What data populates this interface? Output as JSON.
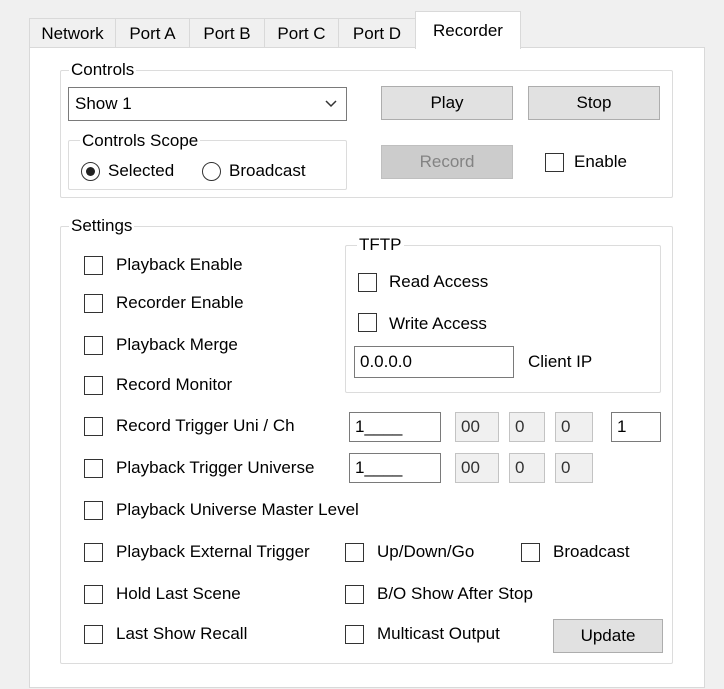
{
  "tabs": [
    {
      "label": "Network"
    },
    {
      "label": "Port A"
    },
    {
      "label": "Port B"
    },
    {
      "label": "Port C"
    },
    {
      "label": "Port D"
    },
    {
      "label": "Recorder"
    }
  ],
  "controls": {
    "group_label": "Controls",
    "show_select": {
      "value": "Show 1"
    },
    "play_label": "Play",
    "stop_label": "Stop",
    "record_label": "Record",
    "enable_label": "Enable",
    "scope": {
      "group_label": "Controls Scope",
      "selected_label": "Selected",
      "broadcast_label": "Broadcast",
      "selected_value": "Selected"
    }
  },
  "settings": {
    "group_label": "Settings",
    "playback_enable": "Playback Enable",
    "recorder_enable": "Recorder Enable",
    "playback_merge": "Playback Merge",
    "record_monitor": "Record Monitor",
    "record_trigger": "Record Trigger Uni / Ch",
    "playback_trigger": "Playback Trigger Universe",
    "playback_master": "Playback Universe Master Level",
    "playback_external": "Playback External Trigger",
    "up_down_go": "Up/Down/Go",
    "broadcast": "Broadcast",
    "hold_last_scene": "Hold Last Scene",
    "bo_show_after_stop": "B/O Show After Stop",
    "last_show_recall": "Last Show Recall",
    "multicast_output": "Multicast Output",
    "update_label": "Update",
    "record_trigger_fields": [
      "1____",
      "00",
      "0",
      "0",
      "1"
    ],
    "playback_trigger_fields": [
      "1____",
      "00",
      "0",
      "0"
    ],
    "tftp": {
      "group_label": "TFTP",
      "read_access": "Read Access",
      "write_access": "Write Access",
      "client_ip_value": "0.0.0.0",
      "client_ip_label": "Client IP"
    }
  }
}
